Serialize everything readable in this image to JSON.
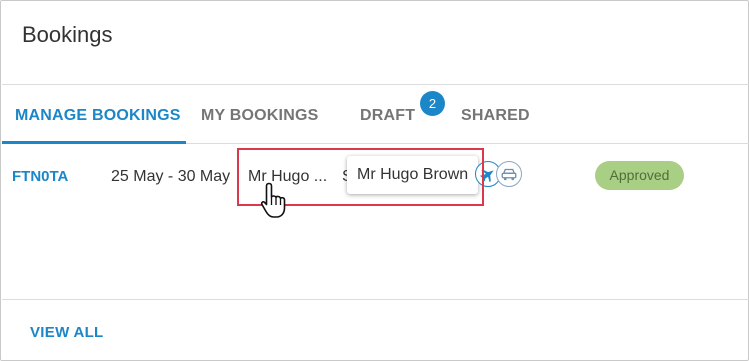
{
  "header": {
    "title": "Bookings"
  },
  "tabs": [
    {
      "label": "MANAGE BOOKINGS",
      "active": true
    },
    {
      "label": "MY BOOKINGS",
      "active": false
    },
    {
      "label": "DRAFT",
      "active": false,
      "badge": "2"
    },
    {
      "label": "SHARED",
      "active": false
    }
  ],
  "booking": {
    "reference": "FTN0TA",
    "dates": "25 May - 30 May",
    "traveller_truncated": "Mr Hugo ...",
    "second_truncated": "S",
    "tooltip": "Mr Hugo Brown",
    "icons": [
      "plane-icon",
      "car-icon"
    ],
    "status": "Approved"
  },
  "footer": {
    "view_all": "VIEW ALL"
  },
  "colors": {
    "accent": "#1b86c8",
    "status_approved_bg": "#a8cf83",
    "highlight_border": "#d9394b"
  }
}
